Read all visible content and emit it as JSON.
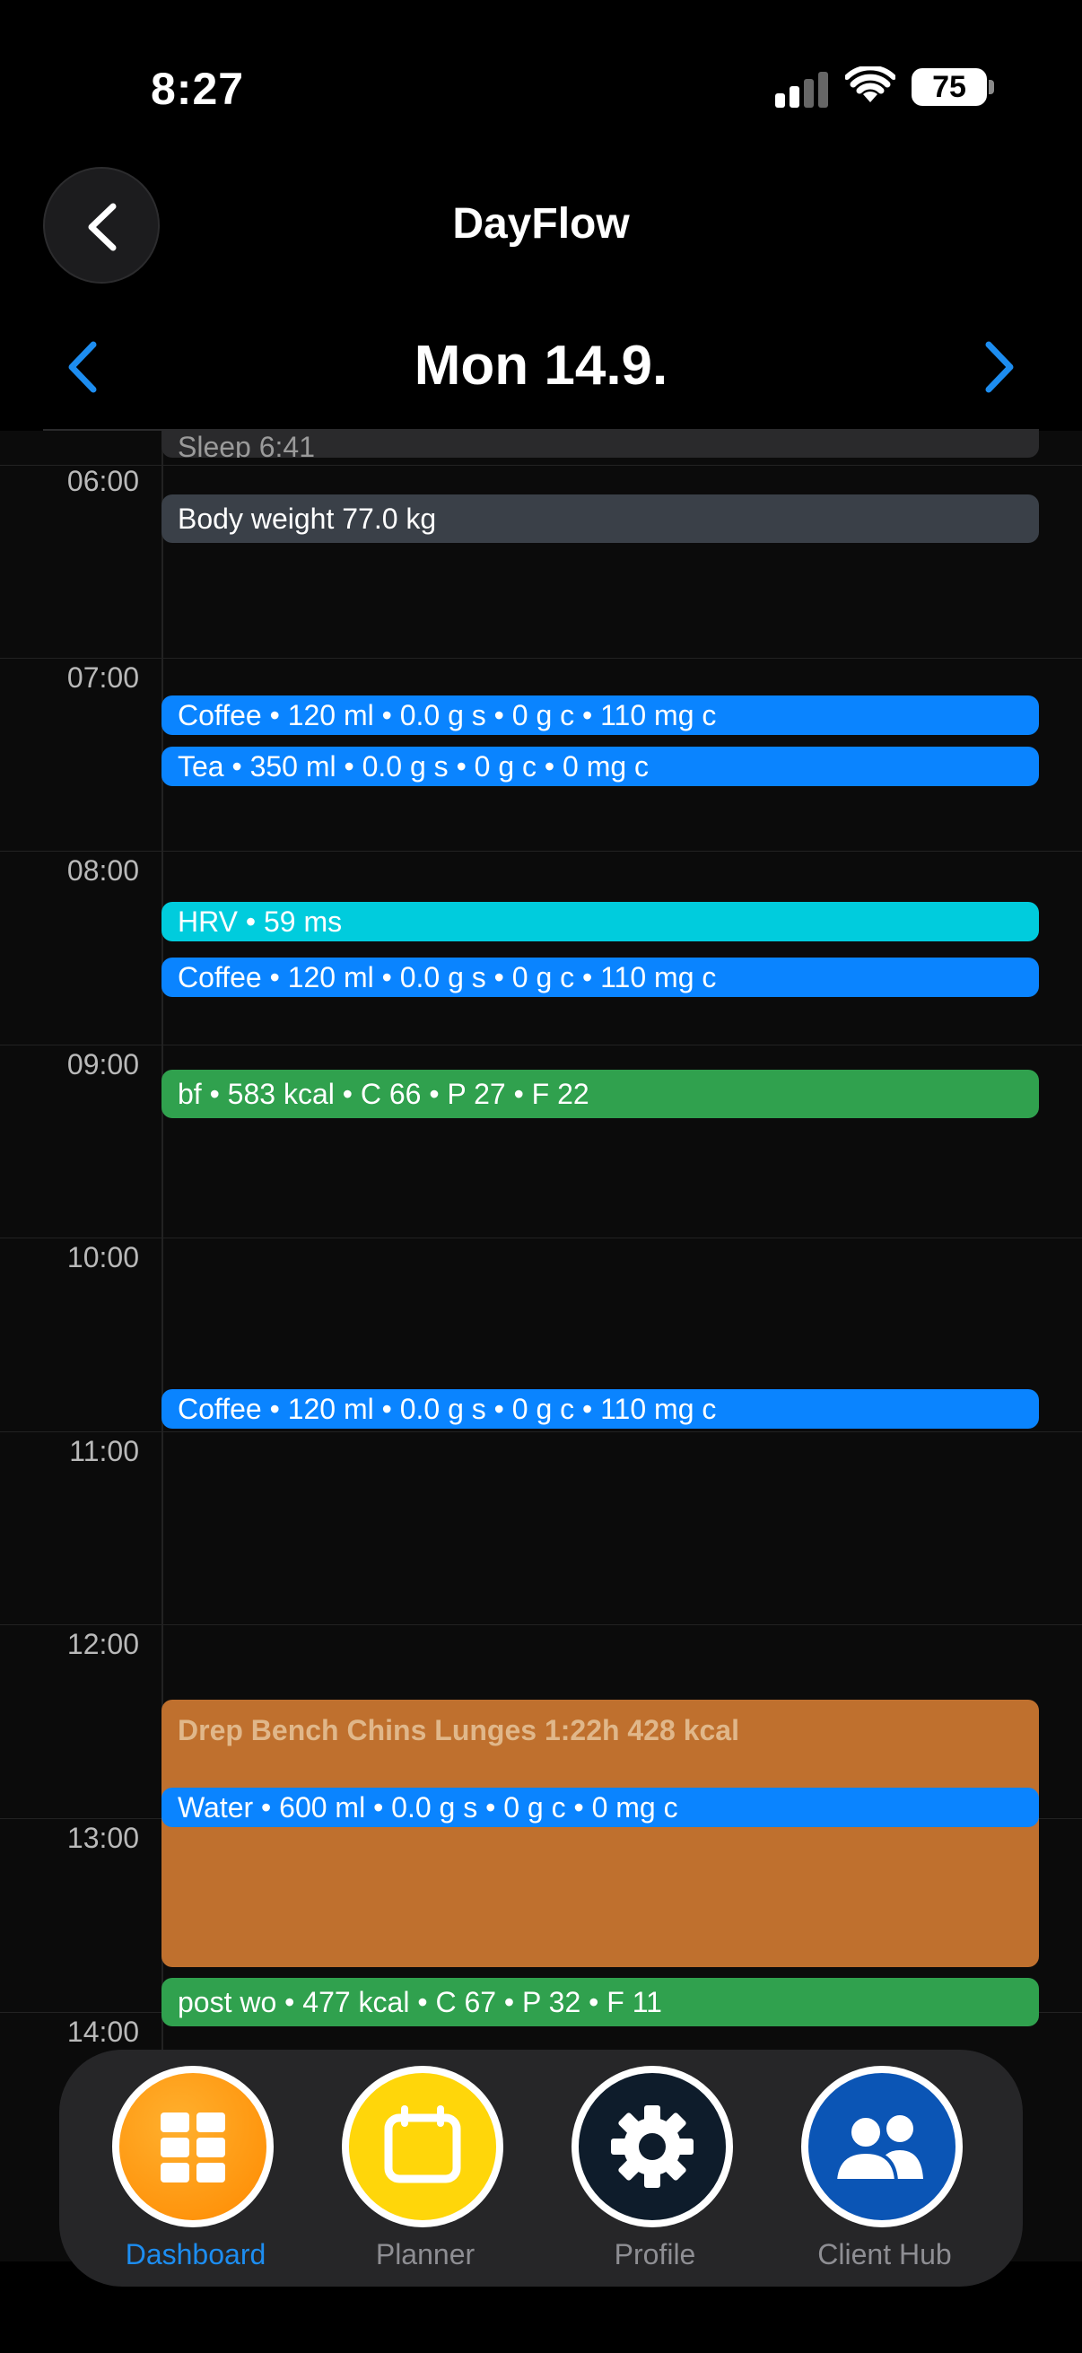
{
  "status_bar": {
    "time": "8:27",
    "battery": "75"
  },
  "header": {
    "title": "DayFlow"
  },
  "date_nav": {
    "title": "Mon 14.9."
  },
  "timeline": {
    "hours": [
      "06:00",
      "07:00",
      "08:00",
      "09:00",
      "10:00",
      "11:00",
      "12:00",
      "13:00",
      "14:00"
    ],
    "events": [
      {
        "label": "Sleep 6:41",
        "color": "#2a2a2c"
      },
      {
        "label": "Body weight 77.0 kg",
        "color": "#3a4048"
      },
      {
        "label": "Coffee • 120 ml • 0.0 g s • 0 g c • 110 mg c",
        "color": "#0a84ff"
      },
      {
        "label": "Tea • 350 ml • 0.0 g s • 0 g c • 0 mg c",
        "color": "#0a84ff"
      },
      {
        "label": "HRV • 59 ms",
        "color": "#00ccdd"
      },
      {
        "label": "Coffee • 120 ml • 0.0 g s • 0 g c • 110 mg c",
        "color": "#0a84ff"
      },
      {
        "label": "bf   • 583 kcal • C 66 • P 27 • F 22",
        "color": "#30a14e"
      },
      {
        "label": "Coffee • 120 ml • 0.0 g s • 0 g c • 110 mg c",
        "color": "#0a84ff"
      },
      {
        "label": "Drep Bench Chins Lunges 1:22h 428 kcal",
        "color": "#bf702e"
      },
      {
        "label": "Water • 600 ml • 0.0 g s • 0 g c • 0 mg c",
        "color": "#0a84ff"
      },
      {
        "label": "post wo   • 477 kcal • C 67 • P 32 • F 11",
        "color": "#30a14e"
      }
    ]
  },
  "tabs": [
    {
      "label": "Dashboard",
      "icon": "grid-icon",
      "active": true
    },
    {
      "label": "Planner",
      "icon": "calendar-icon",
      "active": false
    },
    {
      "label": "Profile",
      "icon": "gear-icon",
      "active": false
    },
    {
      "label": "Client Hub",
      "icon": "people-icon",
      "active": false
    }
  ]
}
